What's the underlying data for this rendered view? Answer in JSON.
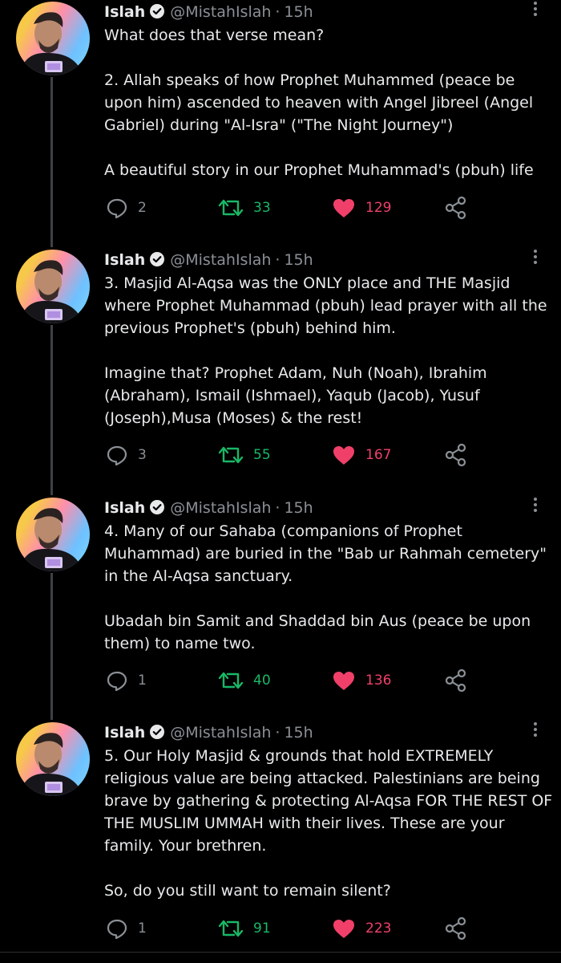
{
  "colors": {
    "background": "#000000",
    "text": "#e7e9ea",
    "muted": "#8b9096",
    "verified": "#e7e9ea",
    "retweet": "#19b866",
    "like": "#f0406a",
    "thread_line": "#3e4144"
  },
  "tweets": [
    {
      "name": "Islah",
      "handle": "@MistahIslah",
      "separator": "·",
      "time": "15h",
      "text": "What does that verse mean?\n\n2. Allah speaks of how Prophet Muhammed (peace be upon him) ascended to heaven with Angel Jibreel (Angel Gabriel) during \"Al-Isra\" (\"The Night Journey\")\n\nA beautiful story in our Prophet Muhammad's (pbuh) life",
      "replies": "2",
      "retweets": "33",
      "likes": "129",
      "liked": true,
      "retweeted": true
    },
    {
      "name": "Islah",
      "handle": "@MistahIslah",
      "separator": "·",
      "time": "15h",
      "text": "3. Masjid Al-Aqsa was the ONLY place and THE Masjid where Prophet Muhammad (pbuh) lead prayer with all the previous Prophet's (pbuh) behind him.\n\nImagine that? Prophet Adam, Nuh (Noah), Ibrahim (Abraham), Ismail (Ishmael), Yaqub (Jacob), Yusuf (Joseph),Musa (Moses) & the rest!",
      "replies": "3",
      "retweets": "55",
      "likes": "167",
      "liked": true,
      "retweeted": true
    },
    {
      "name": "Islah",
      "handle": "@MistahIslah",
      "separator": "·",
      "time": "15h",
      "text": "4. Many of our Sahaba (companions of Prophet Muhammad) are buried in the \"Bab ur Rahmah cemetery\" in the Al-Aqsa sanctuary.\n\nUbadah bin Samit and Shaddad bin Aus (peace be upon them) to name two.",
      "replies": "1",
      "retweets": "40",
      "likes": "136",
      "liked": true,
      "retweeted": true
    },
    {
      "name": "Islah",
      "handle": "@MistahIslah",
      "separator": "·",
      "time": "15h",
      "text": "5. Our Holy Masjid & grounds that hold EXTREMELY religious value are being attacked. Palestinians are being brave by gathering & protecting Al-Aqsa FOR THE REST OF THE MUSLIM UMMAH with their lives. These are your family. Your brethren.\n\nSo, do you still want to remain silent?",
      "replies": "1",
      "retweets": "91",
      "likes": "223",
      "liked": true,
      "retweeted": true
    }
  ],
  "icons": {
    "verified": "verified-badge-icon",
    "more": "more-options-icon",
    "reply": "reply-bubble-icon",
    "retweet": "retweet-icon",
    "like": "heart-icon",
    "share": "share-icon"
  }
}
